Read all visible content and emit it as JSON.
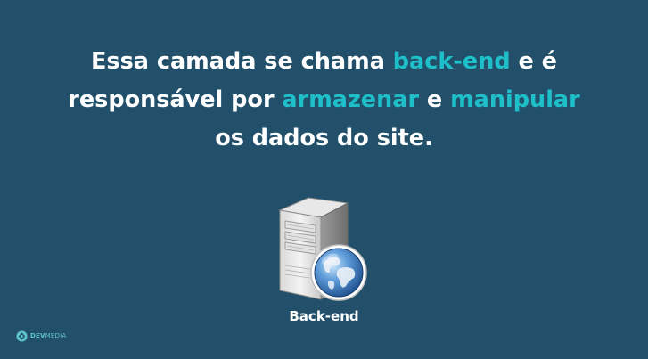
{
  "slide": {
    "headline": {
      "part1": "Essa camada se chama ",
      "highlight1": "back-end",
      "part2": " e é",
      "part3": "responsável por ",
      "highlight2": "armazenar",
      "part4": " e ",
      "highlight3": "manipular",
      "part5": "os dados do site."
    },
    "server_icon": "server-globe-icon",
    "caption": "Back-end"
  },
  "brand": {
    "logo_icon": "devmedia-logo-icon",
    "name_bold": "DEV",
    "name_light": "MEDIA"
  },
  "colors": {
    "background": "#22506a",
    "text": "#ffffff",
    "highlight": "#1ebfc9"
  }
}
